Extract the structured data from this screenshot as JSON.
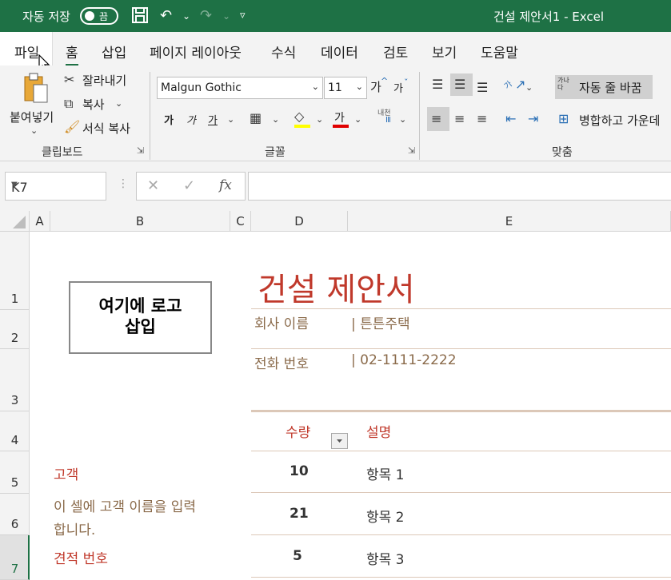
{
  "titlebar": {
    "autosave_label": "자동 저장",
    "autosave_state": "끔",
    "doc_title": "건설 제안서1  -  Excel"
  },
  "tabs": [
    "파일",
    "홈",
    "삽입",
    "페이지 레이아웃",
    "수식",
    "데이터",
    "검토",
    "보기",
    "도움말"
  ],
  "ribbon": {
    "clipboard": {
      "paste": "붙여넣기",
      "cut": "잘라내기",
      "copy": "복사",
      "format_painter": "서식 복사",
      "group": "클립보드"
    },
    "font": {
      "name": "Malgun Gothic",
      "size": "11",
      "grow": "가",
      "shrink": "가",
      "bold": "가",
      "italic": "가",
      "underline": "가",
      "font_color_glyph": "가",
      "phonetic_top": "내천",
      "phonetic_bottom": "Ⅲ",
      "group": "글꼴"
    },
    "alignment": {
      "wrap_text_icon": "가나다",
      "wrap_text": "자동 줄 바꿈",
      "merge_center": "병합하고 가운데",
      "orientation_icon": "가",
      "group": "맞춤"
    }
  },
  "formula_bar": {
    "name_box": "K7",
    "fx": "fx",
    "formula": ""
  },
  "columns": [
    "A",
    "B",
    "C",
    "D",
    "E"
  ],
  "rows": [
    "1",
    "2",
    "3",
    "4",
    "5",
    "6",
    "7"
  ],
  "sheet": {
    "logo_text_line1": "여기에 로고",
    "logo_text_line2": "삽입",
    "title": "건설 제안서",
    "company_label": "회사 이름",
    "company_value": "| 튼튼주택",
    "phone_label": "전화 번호",
    "phone_value": "| 02-1111-2222",
    "qty_header": "수량",
    "desc_header": "설명",
    "customer_label": "고객",
    "customer_hint_line1": "이 셀에 고객 이름을 입력",
    "customer_hint_line2": "합니다.",
    "estimate_label": "견적 번호",
    "items": [
      {
        "qty": "10",
        "desc": "항목 1"
      },
      {
        "qty": "21",
        "desc": "항목 2"
      },
      {
        "qty": "5",
        "desc": "항목 3"
      }
    ]
  },
  "colors": {
    "title_bar": "#1e7145",
    "accent_red": "#c0392b",
    "brown_text": "#8a6a4a"
  }
}
